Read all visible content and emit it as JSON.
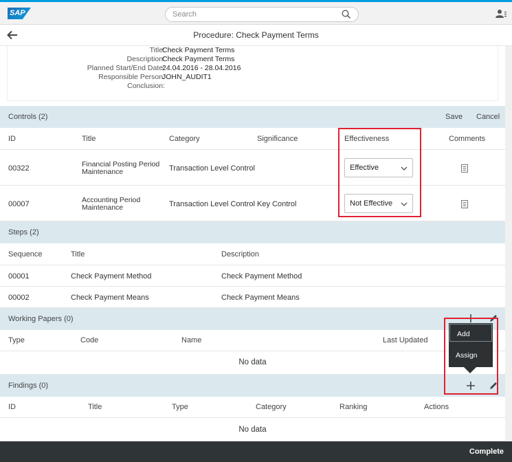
{
  "shell": {
    "logo_text": "SAP",
    "search_placeholder": "Search"
  },
  "page": {
    "title": "Procedure: Check Payment Terms"
  },
  "header": {
    "fields": [
      {
        "label": "Title:",
        "value": "Check Payment Terms"
      },
      {
        "label": "Description:",
        "value": "Check Payment Terms"
      },
      {
        "label": "Planned Start/End Date:",
        "value": "24.04.2016  -  28.04.2016"
      },
      {
        "label": "Responsible Person:",
        "value": "JOHN_AUDIT1"
      },
      {
        "label": "Conclusion:",
        "value": ""
      }
    ]
  },
  "controls": {
    "title": "Controls (2)",
    "save_label": "Save",
    "cancel_label": "Cancel",
    "columns": [
      "ID",
      "Title",
      "Category",
      "Significance",
      "Effectiveness",
      "Comments"
    ],
    "rows": [
      {
        "id": "00322",
        "title": "Financial Posting Period Maintenance",
        "category": "Transaction Level Control",
        "significance": "",
        "effectiveness": "Effective"
      },
      {
        "id": "00007",
        "title": "Accounting Period Maintenance",
        "category": "Transaction Level Control",
        "significance": "Key Control",
        "effectiveness": "Not Effective"
      }
    ]
  },
  "steps": {
    "title": "Steps (2)",
    "columns": [
      "Sequence",
      "Title",
      "Description"
    ],
    "rows": [
      {
        "sequence": "00001",
        "title": "Check Payment Method",
        "description": "Check Payment Method"
      },
      {
        "sequence": "00002",
        "title": "Check Payment Means",
        "description": "Check Payment Means"
      }
    ]
  },
  "working_papers": {
    "title": "Working Papers (0)",
    "columns": [
      "Type",
      "Code",
      "Name",
      "Last Updated"
    ],
    "no_data": "No data"
  },
  "findings": {
    "title": "Findings (0)",
    "columns": [
      "ID",
      "Title",
      "Type",
      "Category",
      "Ranking",
      "Actions"
    ],
    "no_data": "No data"
  },
  "popover": {
    "items": [
      "Add",
      "Assign"
    ]
  },
  "footer": {
    "complete_label": "Complete"
  },
  "colors": {
    "accent": "#009de0",
    "section_bg": "#dbe9ef",
    "footer_bg": "#2f3437",
    "highlight": "#e0212f"
  },
  "icons": [
    "search-icon",
    "user-icon",
    "back-arrow-icon",
    "chevron-down-icon",
    "comment-icon",
    "add-icon",
    "edit-icon"
  ]
}
